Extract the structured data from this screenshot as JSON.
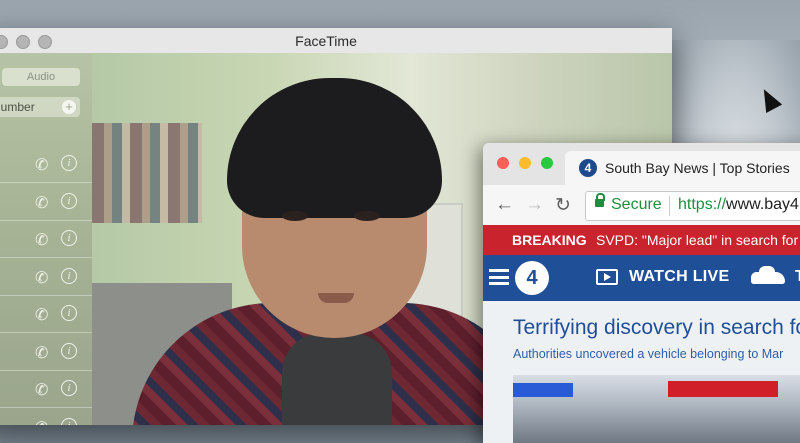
{
  "facetime": {
    "title": "FaceTime",
    "segment_label": "Audio",
    "search_placeholder": "or number",
    "add_symbol": "+",
    "phone_symbol": "✆",
    "info_symbol": "i",
    "contact_rows": 8
  },
  "browser": {
    "tab_title": "South Bay News | Top Stories",
    "favicon_text": "4",
    "back_symbol": "←",
    "forward_symbol": "→",
    "reload_symbol": "↻",
    "secure_label": "Secure",
    "url_scheme": "https://",
    "url_rest": "www.bay4",
    "traffic_light_colors": [
      "#fc5f57",
      "#fdbc2e",
      "#28c840"
    ]
  },
  "news": {
    "breaking_label": "BREAKING",
    "breaking_headline": "SVPD: \"Major lead\" in search for Ma",
    "logo_text": "4",
    "watch_live_label": "WATCH LIVE",
    "next_nav_label": "T",
    "headline": "Terrifying discovery in search fo",
    "subheadline": "Authorities uncovered a vehicle belonging to Mar"
  },
  "colors": {
    "breaking_red": "#c9242d",
    "nav_blue": "#1f4f97",
    "secure_green": "#1e8e3e"
  }
}
